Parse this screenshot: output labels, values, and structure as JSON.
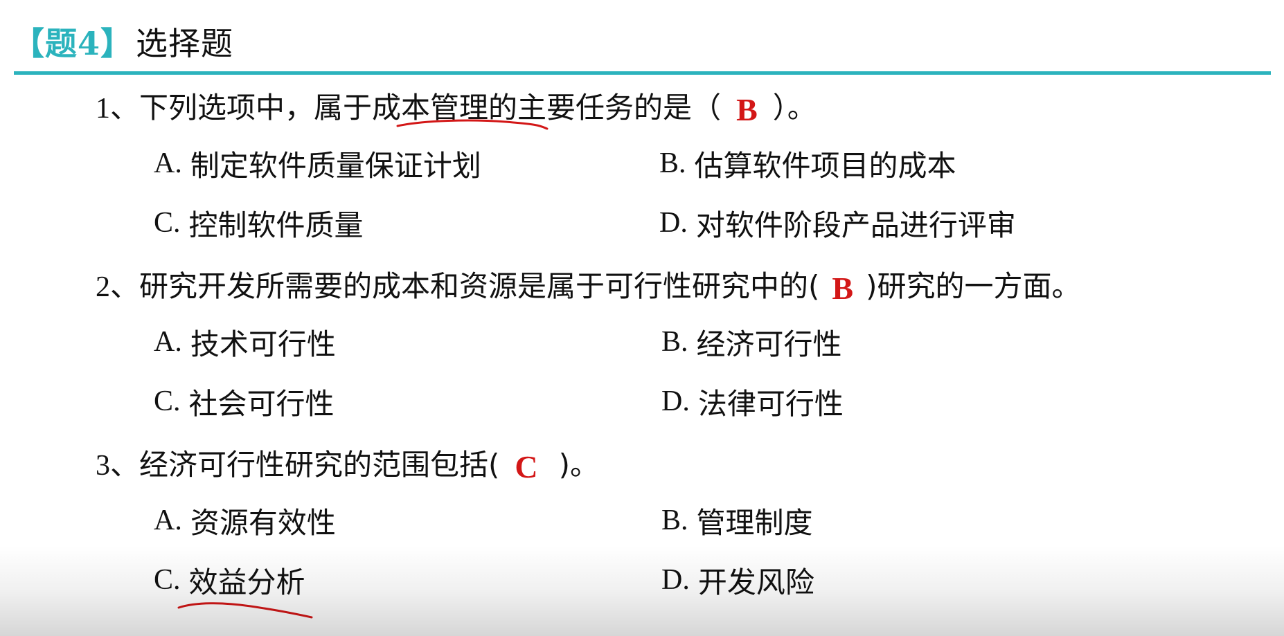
{
  "header": {
    "tag": "【题4】",
    "title": "选择题"
  },
  "questions": [
    {
      "number": "1、",
      "text_before": "下列选项中，属于",
      "text_underlined": "成本管理",
      "text_after": "的主要任务的是（",
      "answer": "B",
      "text_end": "）。",
      "options": [
        {
          "letter": "A.",
          "text": "制定软件质量保证计划"
        },
        {
          "letter": "B.",
          "text": "估算软件项目的成本"
        },
        {
          "letter": "C.",
          "text": "控制软件质量"
        },
        {
          "letter": "D.",
          "text": "对软件阶段产品进行评审"
        }
      ]
    },
    {
      "number": "2、",
      "text_before": "研究开发所需要的成本和资源是属于可行性研究中的(",
      "answer": "B",
      "text_end": ")研究的一方面。",
      "options": [
        {
          "letter": "A.",
          "text": "技术可行性"
        },
        {
          "letter": "B.",
          "text": "经济可行性"
        },
        {
          "letter": "C.",
          "text": "社会可行性"
        },
        {
          "letter": "D.",
          "text": "法律可行性"
        }
      ]
    },
    {
      "number": "3、",
      "text_before": "经济可行性研究的范围包括(",
      "answer": "C",
      "text_end": ")。",
      "options": [
        {
          "letter": "A.",
          "text": "资源有效性"
        },
        {
          "letter": "B.",
          "text": "管理制度"
        },
        {
          "letter": "C.",
          "text": "效益分析"
        },
        {
          "letter": "D.",
          "text": "开发风险"
        }
      ]
    }
  ],
  "colors": {
    "accent": "#2bb3bd",
    "answer": "#d31717",
    "annotation": "#d31717"
  }
}
